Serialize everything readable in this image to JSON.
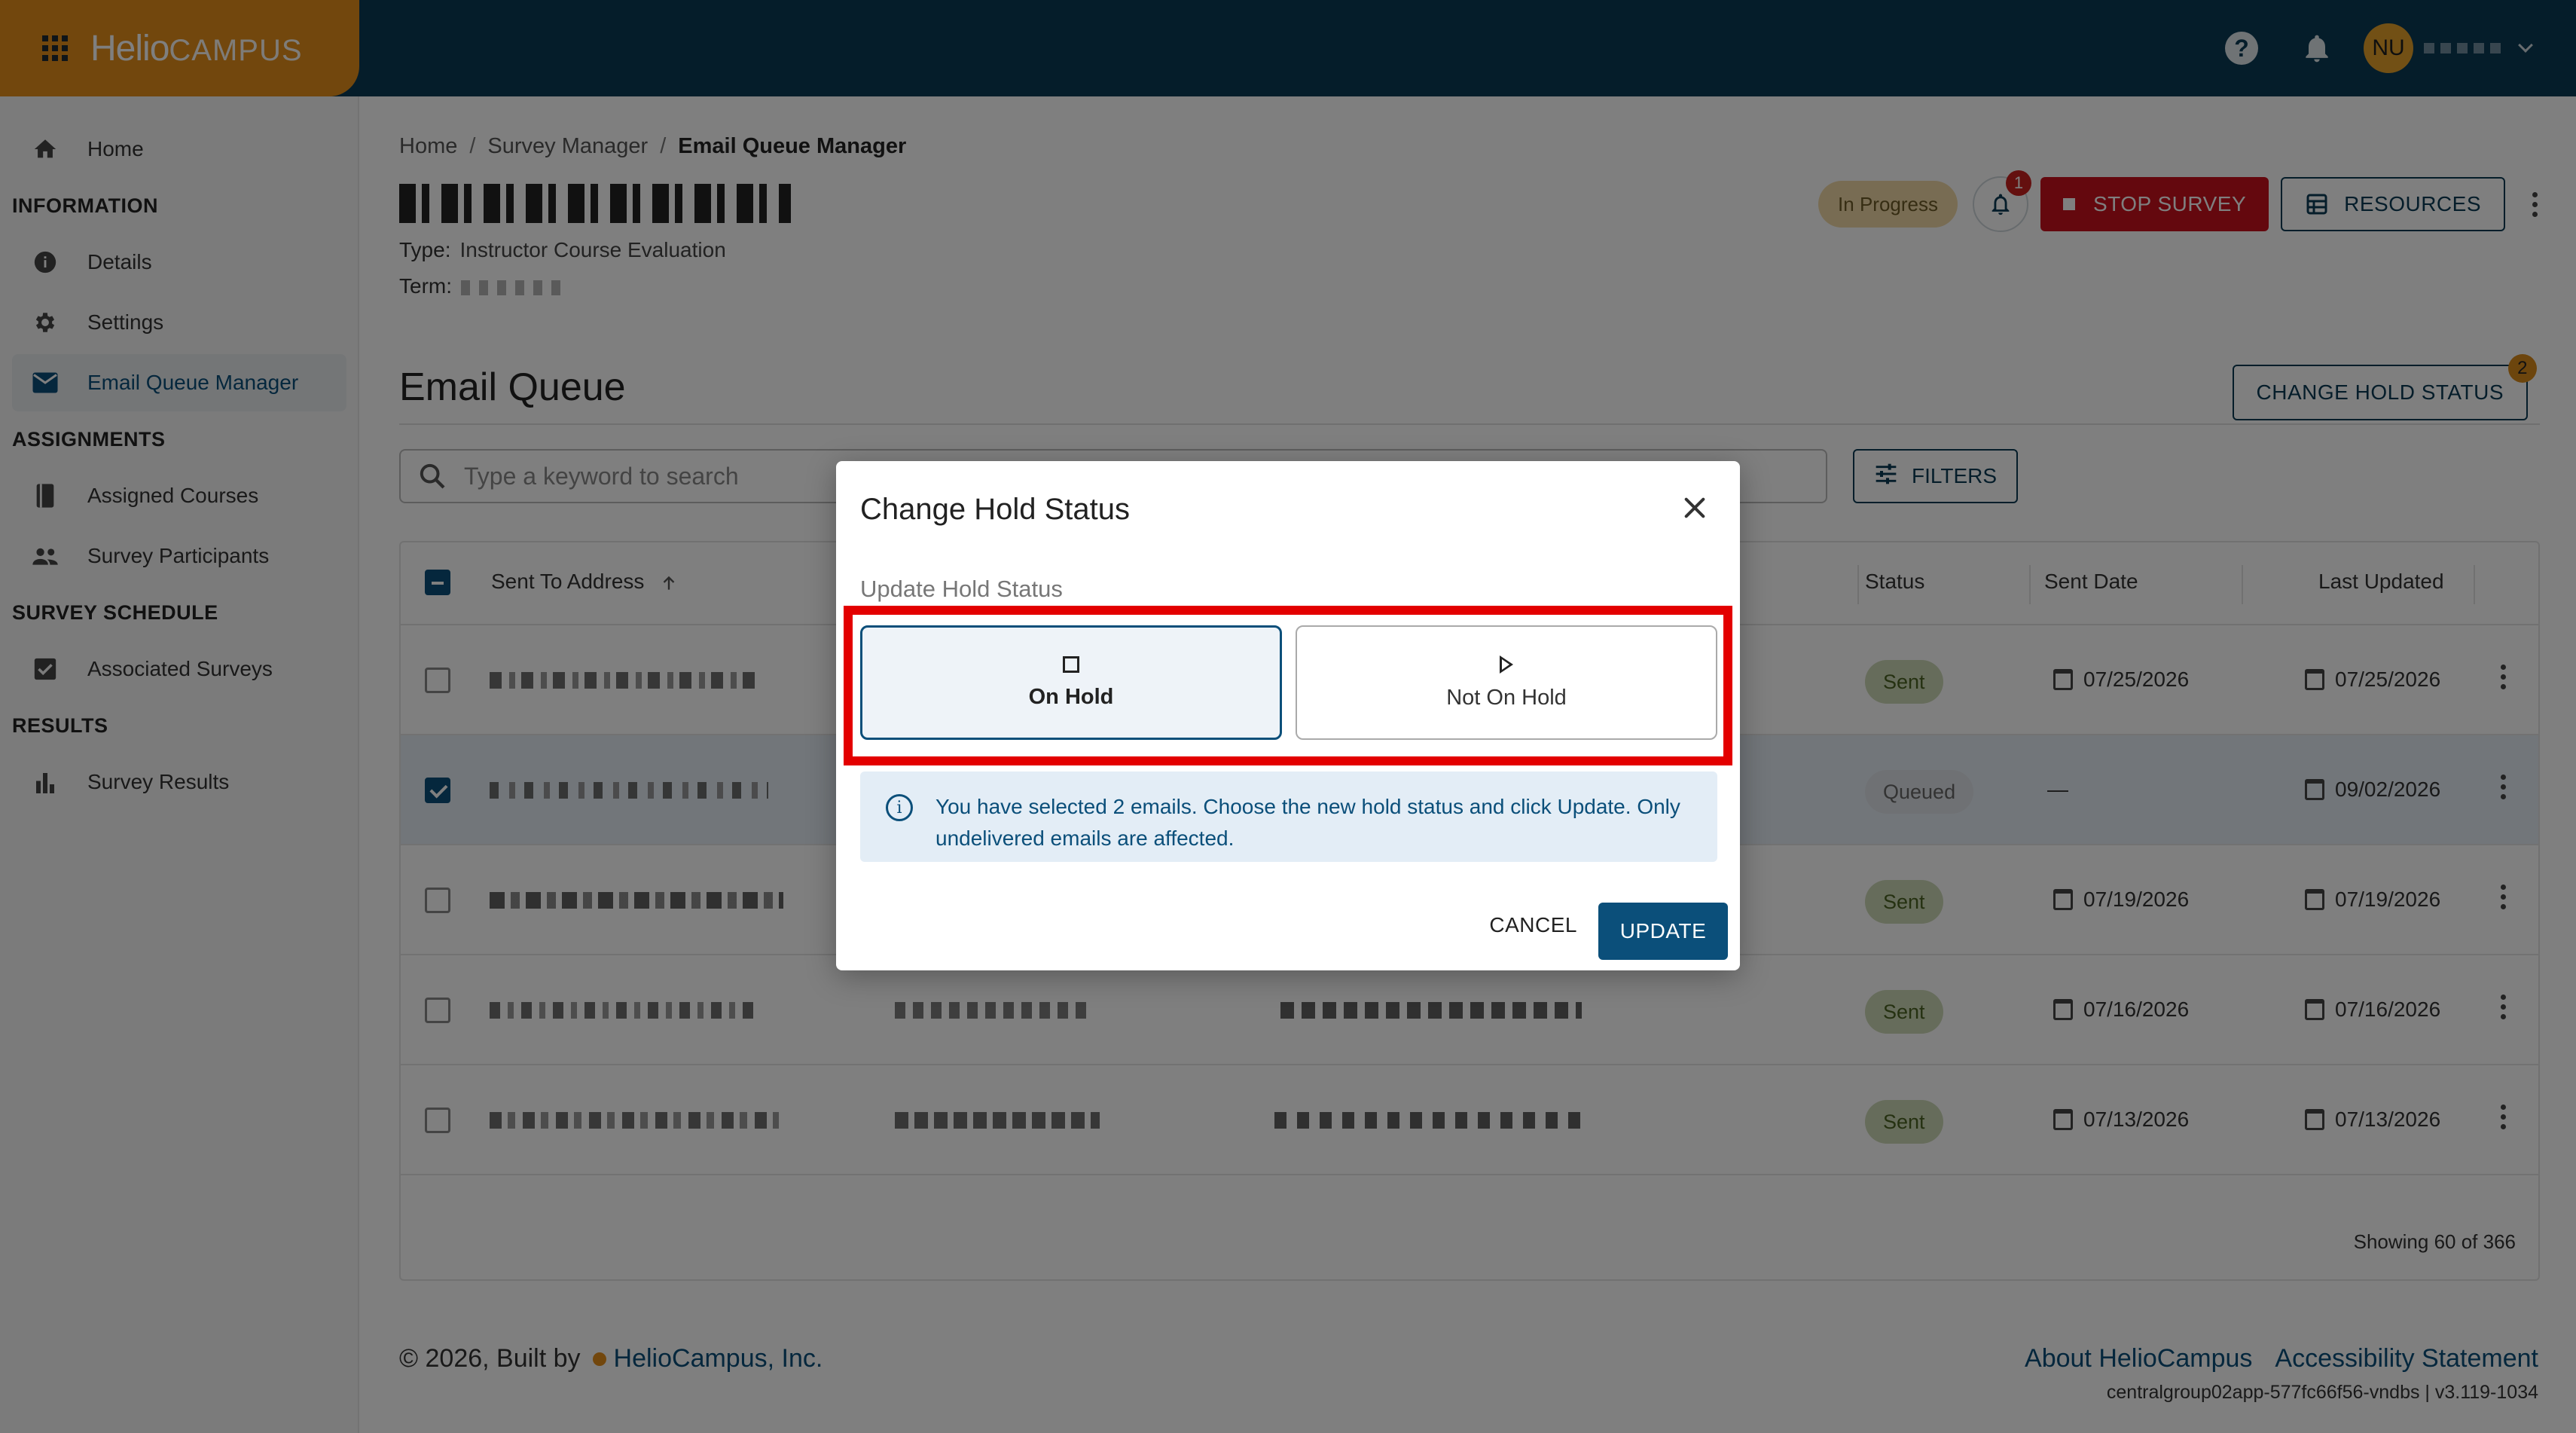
{
  "app": {
    "brand_part1": "Helio",
    "brand_part2": "CAMPUS",
    "avatar_initials": "NU",
    "help_glyph": "?"
  },
  "sidebar": {
    "home": "Home",
    "sec_information": "INFORMATION",
    "details": "Details",
    "settings": "Settings",
    "email_queue_manager": "Email Queue Manager",
    "sec_assignments": "ASSIGNMENTS",
    "assigned_courses": "Assigned Courses",
    "survey_participants": "Survey Participants",
    "sec_survey_schedule": "SURVEY SCHEDULE",
    "associated_surveys": "Associated Surveys",
    "sec_results": "RESULTS",
    "survey_results": "Survey Results"
  },
  "breadcrumb": {
    "home": "Home",
    "survey_manager": "Survey Manager",
    "current": "Email Queue Manager",
    "separator": "/"
  },
  "survey": {
    "type_label": "Type:",
    "type_value": "Instructor Course Evaluation",
    "term_label": "Term:"
  },
  "header_actions": {
    "status": "In Progress",
    "notification_count": "1",
    "stop_label": "STOP SURVEY",
    "resources_label": "RESOURCES"
  },
  "email_queue": {
    "title": "Email Queue",
    "change_hold_label": "CHANGE HOLD STATUS",
    "change_hold_badge": "2",
    "search_placeholder": "Type a keyword to search",
    "filters_label": "FILTERS",
    "columns": {
      "sent_to": "Sent To Address",
      "status": "Status",
      "sent_date": "Sent Date",
      "last_updated": "Last Updated"
    },
    "rows": [
      {
        "status": "Sent",
        "sent_date": "07/25/2026",
        "last_updated": "07/25/2026",
        "selected": false
      },
      {
        "status": "Queued",
        "sent_date": "—",
        "last_updated": "09/02/2026",
        "selected": true
      },
      {
        "status": "Sent",
        "sent_date": "07/19/2026",
        "last_updated": "07/19/2026",
        "selected": false
      },
      {
        "status": "Sent",
        "sent_date": "07/16/2026",
        "last_updated": "07/16/2026",
        "selected": false
      },
      {
        "status": "Sent",
        "sent_date": "07/13/2026",
        "last_updated": "07/13/2026",
        "selected": false
      }
    ],
    "showing": "Showing 60 of 366"
  },
  "footer": {
    "copyright": "© 2026, Built by",
    "company": "HelioCampus, Inc.",
    "about": "About HelioCampus",
    "accessibility": "Accessibility Statement",
    "version": "centralgroup02app-577fc66f56-vndbs | v3.119-1034"
  },
  "modal": {
    "title": "Change Hold Status",
    "subtitle": "Update Hold Status",
    "option_on_hold": "On Hold",
    "option_not_on_hold": "Not On Hold",
    "info_text": "You have selected 2 emails. Choose the new hold status and click Update. Only undelivered emails are affected.",
    "cancel_label": "CANCEL",
    "update_label": "UPDATE"
  },
  "colors": {
    "topbar": "#0b3a55",
    "brand_orange": "#e58e1a",
    "primary": "#0b4f7a",
    "stop_red": "#c8101d",
    "highlight_red": "#e30000"
  }
}
